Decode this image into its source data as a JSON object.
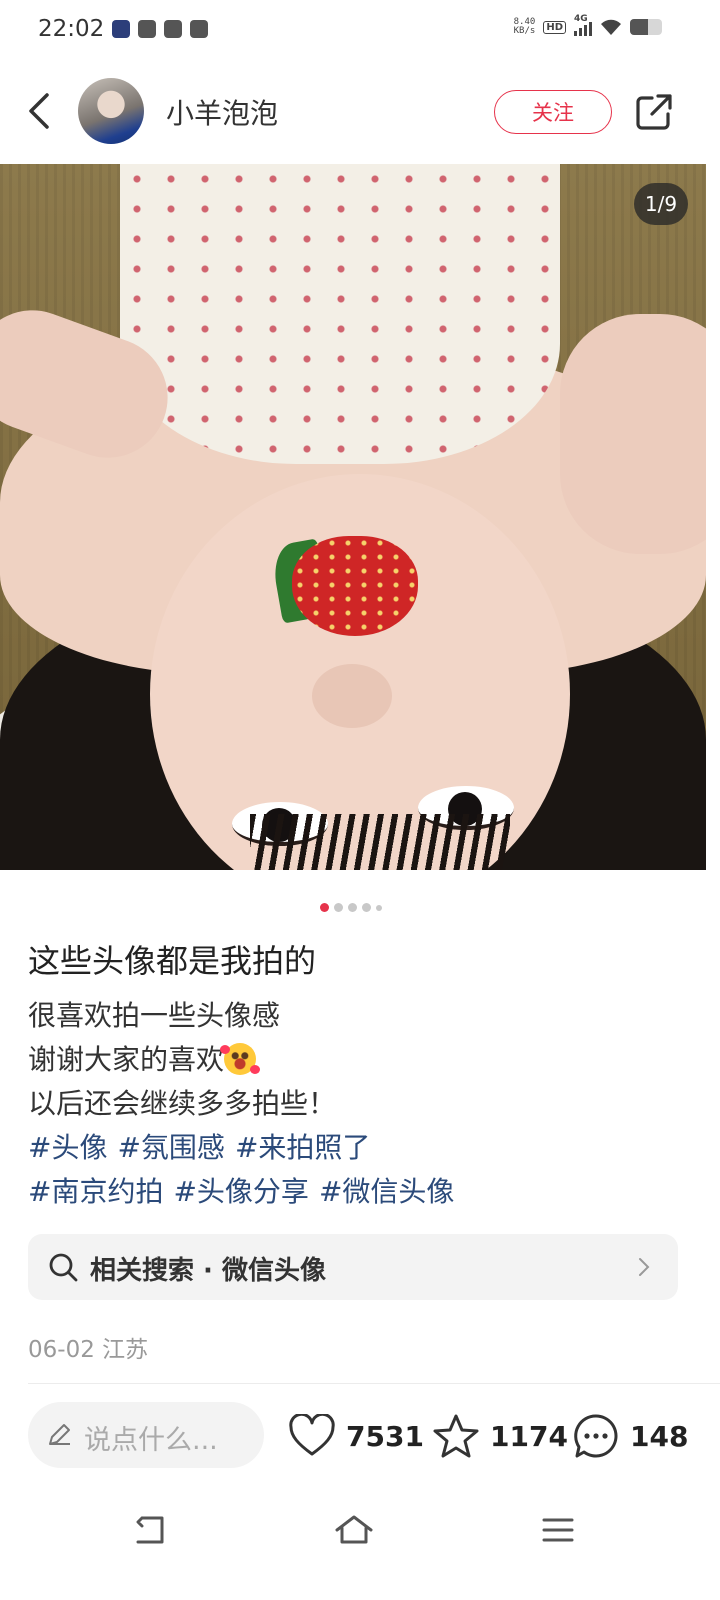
{
  "status_bar": {
    "time": "22:02",
    "net_speed_value": "8.40",
    "net_speed_unit": "KB/s",
    "hd_label": "HD",
    "network_label": "4G",
    "battery_level": 0.55
  },
  "header": {
    "username": "小羊泡泡",
    "follow_label": "关注"
  },
  "media": {
    "page_indicator": "1/9",
    "current_slide": 1,
    "total_slides": 9
  },
  "post": {
    "title": "这些头像都是我拍的",
    "body_lines": [
      "很喜欢拍一些头像感",
      "谢谢大家的喜欢",
      "以后还会继续多多拍些！"
    ],
    "tags_row1": [
      "#头像",
      "#氛围感",
      "#来拍照了"
    ],
    "tags_row2": [
      "#南京约拍",
      "#头像分享",
      "#微信头像"
    ],
    "tag_color": "#2b4a7a"
  },
  "related_search": {
    "label": "相关搜索 · 微信头像"
  },
  "meta": {
    "date_location": "06-02 江苏"
  },
  "bottom_bar": {
    "comment_placeholder": "说点什么...",
    "likes": "7531",
    "favorites": "1174",
    "comments": "148"
  },
  "icons": {
    "back": "chevron-left-icon",
    "share": "share-icon",
    "search": "search-icon",
    "pen": "pen-icon",
    "like": "heart-icon",
    "favorite": "star-icon",
    "comment": "comment-icon"
  },
  "colors": {
    "accent": "#e6334b",
    "hashtag": "#2b4a7a"
  }
}
